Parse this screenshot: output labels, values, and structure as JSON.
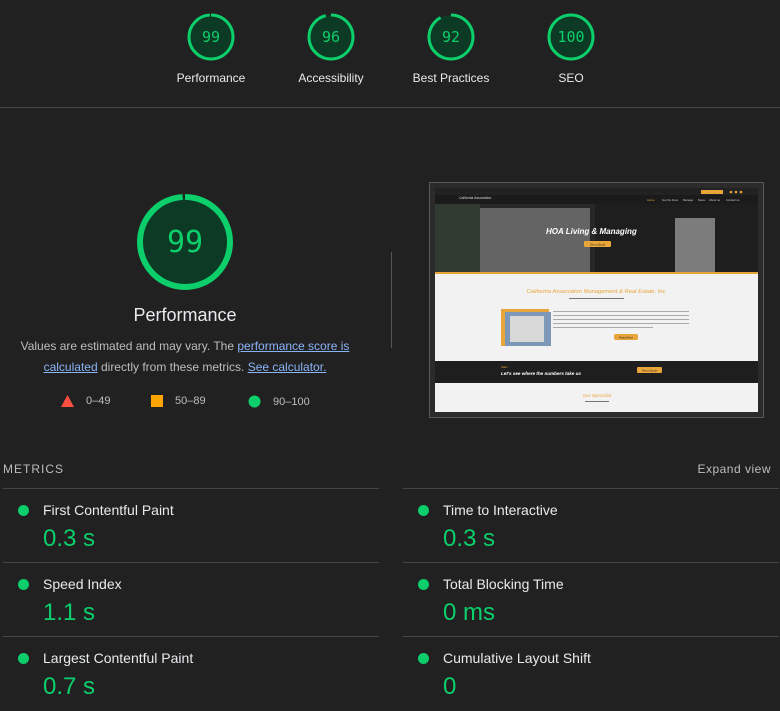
{
  "colors": {
    "pass": "#0cce6b",
    "average": "#ffa400",
    "fail": "#ff4e42"
  },
  "gauges": [
    {
      "score": "99",
      "label": "Performance",
      "fraction": 0.99
    },
    {
      "score": "96",
      "label": "Accessibility",
      "fraction": 0.96
    },
    {
      "score": "92",
      "label": "Best Practices",
      "fraction": 0.92
    },
    {
      "score": "100",
      "label": "SEO",
      "fraction": 1.0
    }
  ],
  "performance": {
    "score": "99",
    "fraction": 0.99,
    "title": "Performance",
    "desc_prefix": "Values are estimated and may vary. The ",
    "link1": "performance score is calculated",
    "desc_mid": " directly from these metrics. ",
    "link2": "See calculator."
  },
  "legend": [
    {
      "icon": "triangle-icon",
      "range": "0–49"
    },
    {
      "icon": "square-icon",
      "range": "50–89"
    },
    {
      "icon": "circle-icon",
      "range": "90–100"
    }
  ],
  "screenshot": {
    "logo_text": "California Association",
    "nav": [
      "Home",
      "Get the Fees",
      "Manage",
      "News",
      "About us",
      "Contact us"
    ],
    "hero_title": "HOA Living & Managing",
    "hero_button": "Get a Quote",
    "section_title": "California Association Management & Real Estate, Inc",
    "about_button": "Read More",
    "numbers_kicker": "Stats",
    "numbers_title": "Let's see where the numbers take us",
    "numbers_button": "Get a Quote",
    "specialist_title": "Our Specialist"
  },
  "metrics": {
    "heading": "METRICS",
    "expand": "Expand view",
    "items": [
      {
        "label": "First Contentful Paint",
        "value": "0.3 s"
      },
      {
        "label": "Time to Interactive",
        "value": "0.3 s"
      },
      {
        "label": "Speed Index",
        "value": "1.1 s"
      },
      {
        "label": "Total Blocking Time",
        "value": "0 ms"
      },
      {
        "label": "Largest Contentful Paint",
        "value": "0.7 s"
      },
      {
        "label": "Cumulative Layout Shift",
        "value": "0"
      }
    ]
  }
}
